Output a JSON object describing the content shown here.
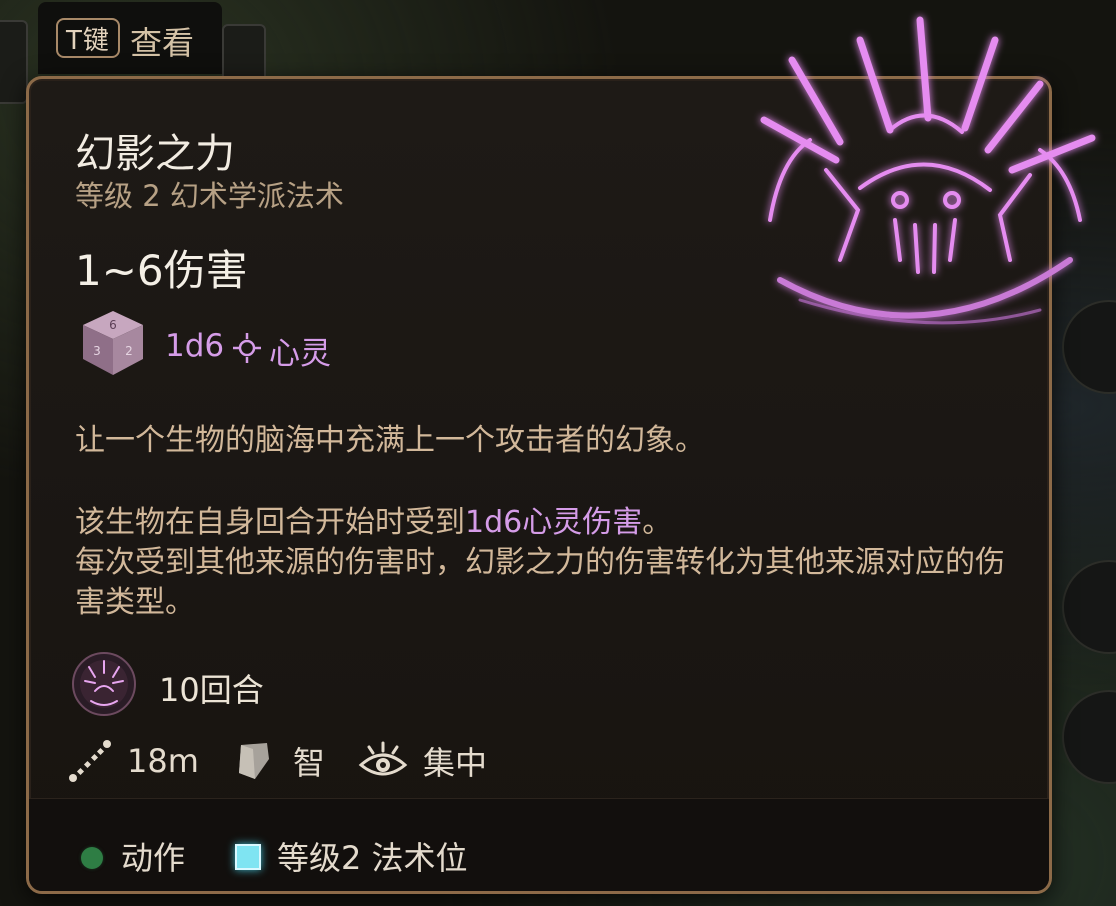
{
  "hint": {
    "key": "T键",
    "label": "查看"
  },
  "spell": {
    "name": "幻影之力",
    "school": "等级 2 幻术学派法术",
    "damage": "1~6伤害",
    "dice": "1d6",
    "damage_type": "心灵",
    "description_line1": "让一个生物的脑海中充满上一个攻击者的幻象。",
    "description_p2_prefix": "该生物在自身回合开始时受到",
    "description_p2_highlight": "1d6心灵伤害",
    "description_p2_suffix": "。",
    "description_p3": "每次受到其他来源的伤害时，幻影之力的伤害转化为其他来源对应的伤害类型。",
    "duration": "10回合",
    "range": "18m",
    "save_ability": "智",
    "concentration": "集中"
  },
  "cost": {
    "action_label": "动作",
    "slot_label": "等级2 法术位"
  },
  "colors": {
    "accent_psychic": "#d59ce8",
    "border": "#8c6a48",
    "action": "#2e7d44",
    "spell_slot": "#7fe4f2"
  },
  "icons": [
    "psychic-spell-art",
    "dice-icon",
    "psychic-damage-icon",
    "duration-icon",
    "range-icon",
    "save-ability-icon",
    "concentration-icon",
    "action-dot-icon",
    "spell-slot-icon"
  ]
}
